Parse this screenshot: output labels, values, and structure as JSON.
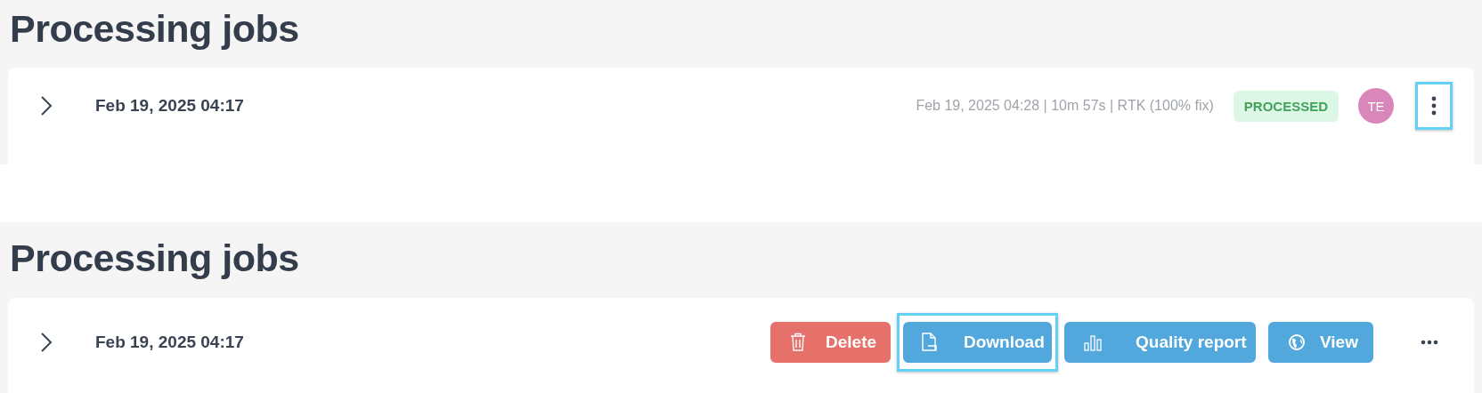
{
  "panels": [
    {
      "title": "Processing jobs",
      "job": {
        "expanded": false,
        "started": "Feb 19, 2025 04:17",
        "details": "Feb 19, 2025 04:28 | 10m 57s | RTK (100% fix)",
        "status": "PROCESSED",
        "avatar": "TE",
        "menu": {
          "vertical": true,
          "highlighted": true
        }
      }
    },
    {
      "title": "Processing jobs",
      "job": {
        "expanded": false,
        "started": "Feb 19, 2025 04:17",
        "actions": [
          {
            "kind": "delete",
            "label": "Delete",
            "highlighted": false
          },
          {
            "kind": "download",
            "label": "Download",
            "highlighted": true
          },
          {
            "kind": "report",
            "label": "Quality report",
            "highlighted": false
          },
          {
            "kind": "view",
            "label": "View",
            "highlighted": false
          }
        ],
        "menu": {
          "vertical": false,
          "highlighted": false
        }
      }
    }
  ]
}
